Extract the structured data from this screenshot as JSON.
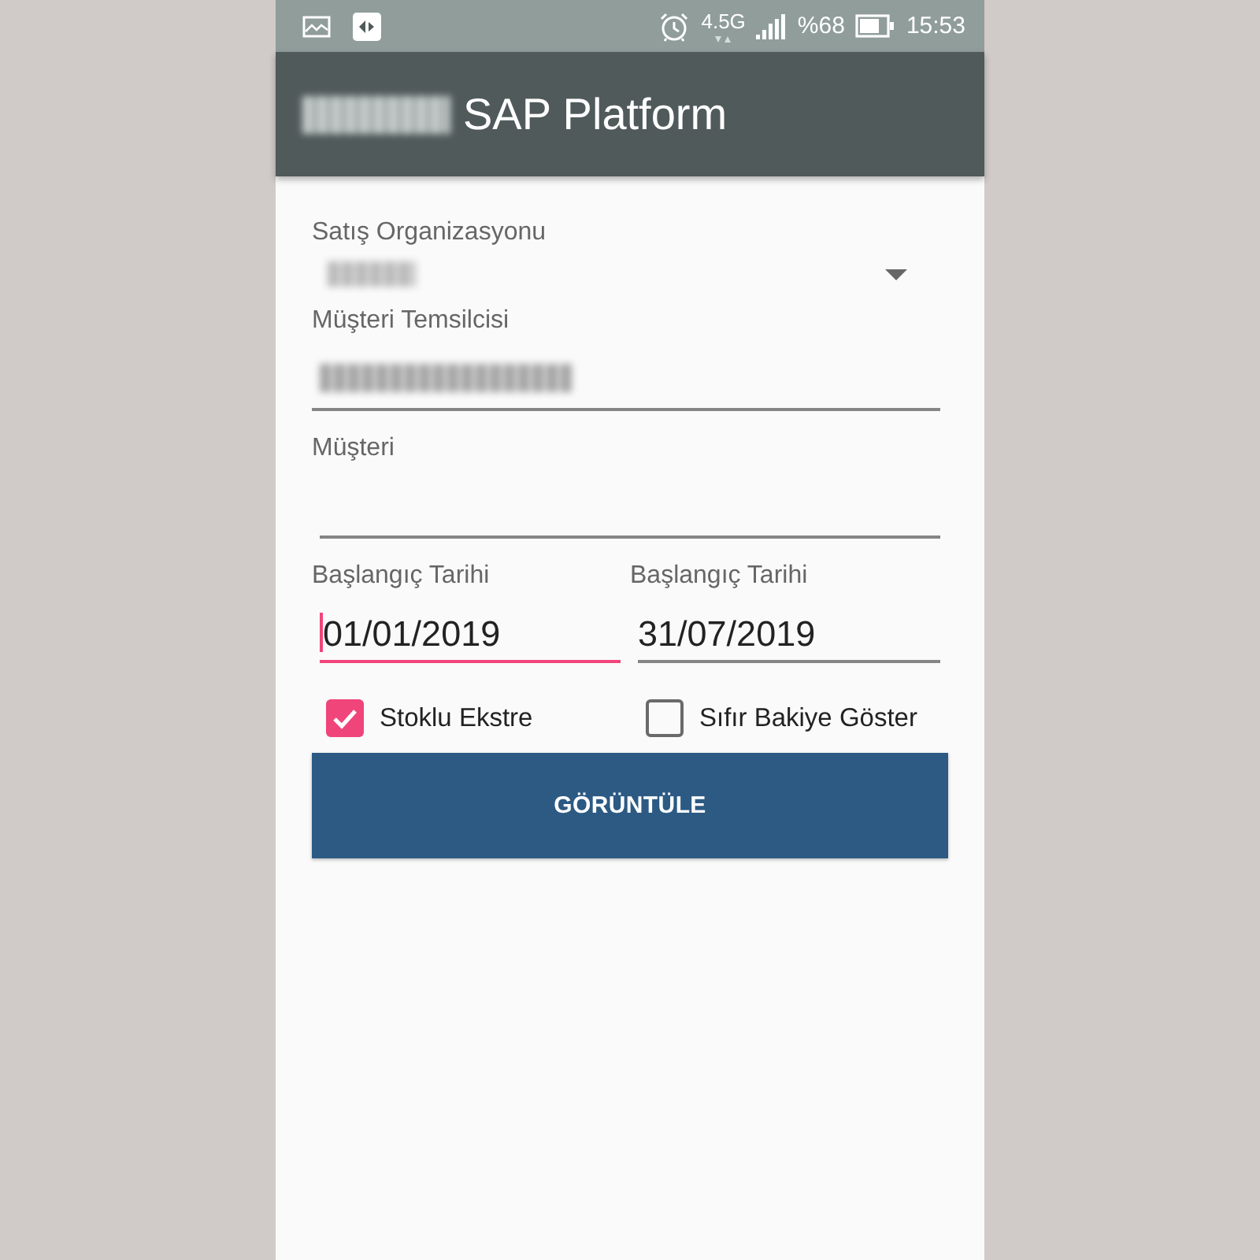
{
  "status_bar": {
    "network": "4.5G",
    "battery_percent": "%68",
    "time": "15:53"
  },
  "app_bar": {
    "prefix_blurred": true,
    "title": "SAP Platform"
  },
  "form": {
    "sales_org": {
      "label": "Satış Organizasyonu",
      "value_blurred": true
    },
    "representative": {
      "label": "Müşteri Temsilcisi",
      "value_blurred": true
    },
    "customer": {
      "label": "Müşteri"
    },
    "dates": [
      {
        "label": "Başlangıç Tarihi",
        "value": "01/01/2019",
        "focused": true
      },
      {
        "label": "Başlangıç Tarihi",
        "value": "31/07/2019",
        "focused": false
      }
    ],
    "checkboxes": [
      {
        "label": "Stoklu Ekstre",
        "checked": true
      },
      {
        "label": "Sıfır Bakiye Göster",
        "checked": false
      }
    ],
    "button": "GÖRÜNTÜLE"
  }
}
